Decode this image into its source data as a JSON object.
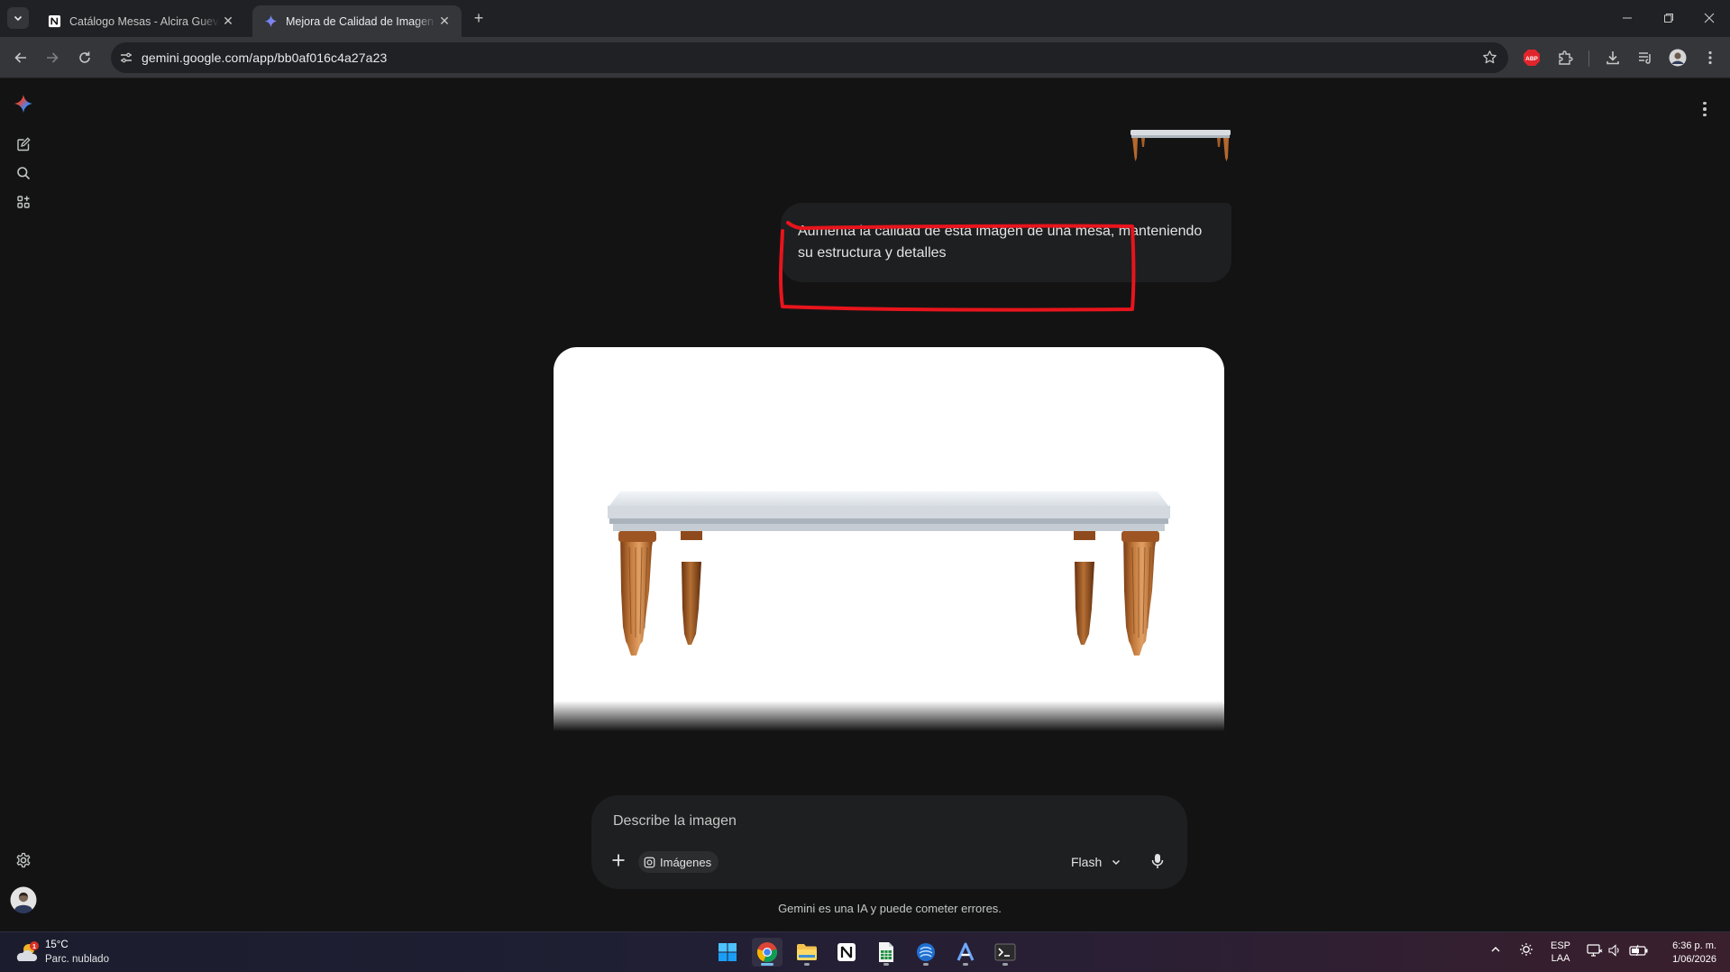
{
  "browser": {
    "tabs": [
      {
        "title": "Catálogo Mesas - Alcira Guevara",
        "active": false
      },
      {
        "title": "Mejora de Calidad de Imagen de Mesa",
        "active": true
      }
    ],
    "url": "gemini.google.com/app/bb0af016c4a27a23",
    "extension_badge": "ABP"
  },
  "chat": {
    "user_prompt": "Aumenta la calidad de esta imagen de una mesa, manteniendo su estructura y detalles",
    "highlight_color": "#e8141c"
  },
  "composer": {
    "placeholder": "Describe la imagen",
    "tool_chip": "Imágenes",
    "model": "Flash"
  },
  "disclaimer": "Gemini es una IA y puede cometer errores.",
  "taskbar": {
    "weather": {
      "temp": "15°C",
      "desc": "Parc. nublado",
      "badge": "1"
    },
    "language": {
      "code": "ESP",
      "layout": "LAA"
    },
    "clock": {
      "time": "6:36 p. m.",
      "date": "1/06/2026"
    }
  },
  "colors": {
    "accent": "#4285f4",
    "background": "#131314",
    "surface": "#1e1f20"
  }
}
